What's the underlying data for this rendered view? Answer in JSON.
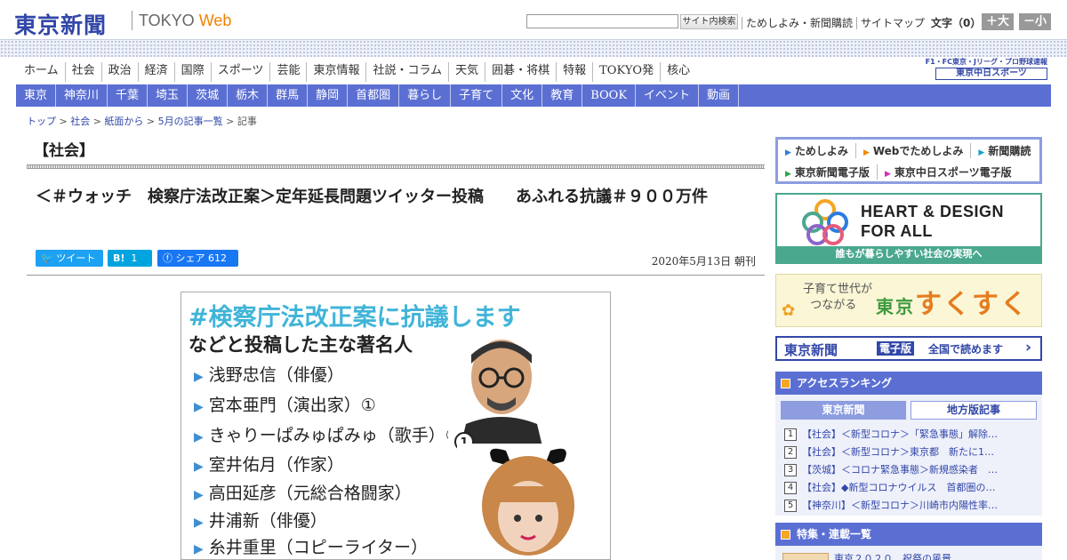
{
  "header": {
    "logo": "東京新聞",
    "logo_sub_a": "TOKYO ",
    "logo_sub_b": "Web",
    "search_button": "サイト内検索",
    "util_links": [
      "ためしよみ・新聞購読",
      "サイトマップ"
    ],
    "font_size_label": "文字（0）",
    "size_up": "＋大",
    "size_down": "－小"
  },
  "main_nav": [
    "ホーム",
    "社会",
    "政治",
    "経済",
    "国際",
    "スポーツ",
    "芸能",
    "東京情報",
    "社説・コラム",
    "天気",
    "囲碁・将棋",
    "特報",
    "TOKYO発",
    "核心"
  ],
  "sports": {
    "links": "F1・FC東京・Jリーグ・プロ野球速報",
    "logo": "東京中日スポーツ"
  },
  "region_nav": [
    "東京",
    "神奈川",
    "千葉",
    "埼玉",
    "茨城",
    "栃木",
    "群馬",
    "静岡",
    "首都圏",
    "暮らし",
    "子育て",
    "文化",
    "教育",
    "BOOK",
    "イベント",
    "動画"
  ],
  "breadcrumb": {
    "items": [
      "トップ",
      "社会",
      "紙面から",
      "5月の記事一覧"
    ],
    "current": "記事",
    "separator": " > "
  },
  "article": {
    "section": "【社会】",
    "title": "＜＃ウォッチ　検察庁法改正案＞定年延長問題ツイッター投稿　　あふれる抗議＃９００万件",
    "tweet_label": "ツイート",
    "hatena_label": "B!",
    "hatena_count": "1",
    "fb_label": "シェア",
    "fb_count": "612",
    "date": "2020年5月13日 朝刊"
  },
  "image": {
    "headline": "#検察庁法改正案に抗議します",
    "subhead": "などと投稿した主な著名人",
    "list": [
      "浅野忠信（俳優）",
      "宮本亜門（演出家）①",
      "きゃりーぱみゅぱみゅ（歌手）②",
      "室井佑月（作家）",
      "高田延彦（元総合格闘家）",
      "井浦新（俳優）",
      "糸井重里（コピーライター）"
    ],
    "photo_badge": "1",
    "accent_color": "#40b4d8"
  },
  "sidebar": {
    "services_row1": [
      "ためしよみ",
      "Webでためしよみ",
      "新聞購読"
    ],
    "services_row2": [
      "東京新聞電子版",
      "東京中日スポーツ電子版"
    ],
    "hdfa_title_1": "HEART & DESIGN",
    "hdfa_title_2": "FOR ALL",
    "hdfa_caption": "誰もが暮らしやすい社会の実現へ",
    "sukusuku_sub_1": "子育て世代が",
    "sukusuku_sub_2": "つながる",
    "sukusuku_title_a": "東京",
    "sukusuku_title_b": "すくすく",
    "epaper_logo": "東京新聞",
    "epaper_tag": "電子版",
    "epaper_text": "全国で読めます",
    "ranking_title": "アクセスランキング",
    "ranking_tabs": [
      "東京新聞",
      "地方版記事"
    ],
    "ranking": [
      {
        "num": "1",
        "text": "【社会】＜新型コロナ＞「緊急事態」解除…"
      },
      {
        "num": "2",
        "text": "【社会】＜新型コロナ＞東京都　新たに1…"
      },
      {
        "num": "3",
        "text": "【茨城】＜コロナ緊急事態＞新規感染者　…"
      },
      {
        "num": "4",
        "text": "【社会】◆新型コロナウイルス　首都圏の…"
      },
      {
        "num": "5",
        "text": "【神奈川】＜新型コロナ＞川崎市内陽性率…"
      }
    ],
    "feature_title": "特集・連載一覧",
    "feature_item": "東京２０２０　祝祭の風景"
  }
}
